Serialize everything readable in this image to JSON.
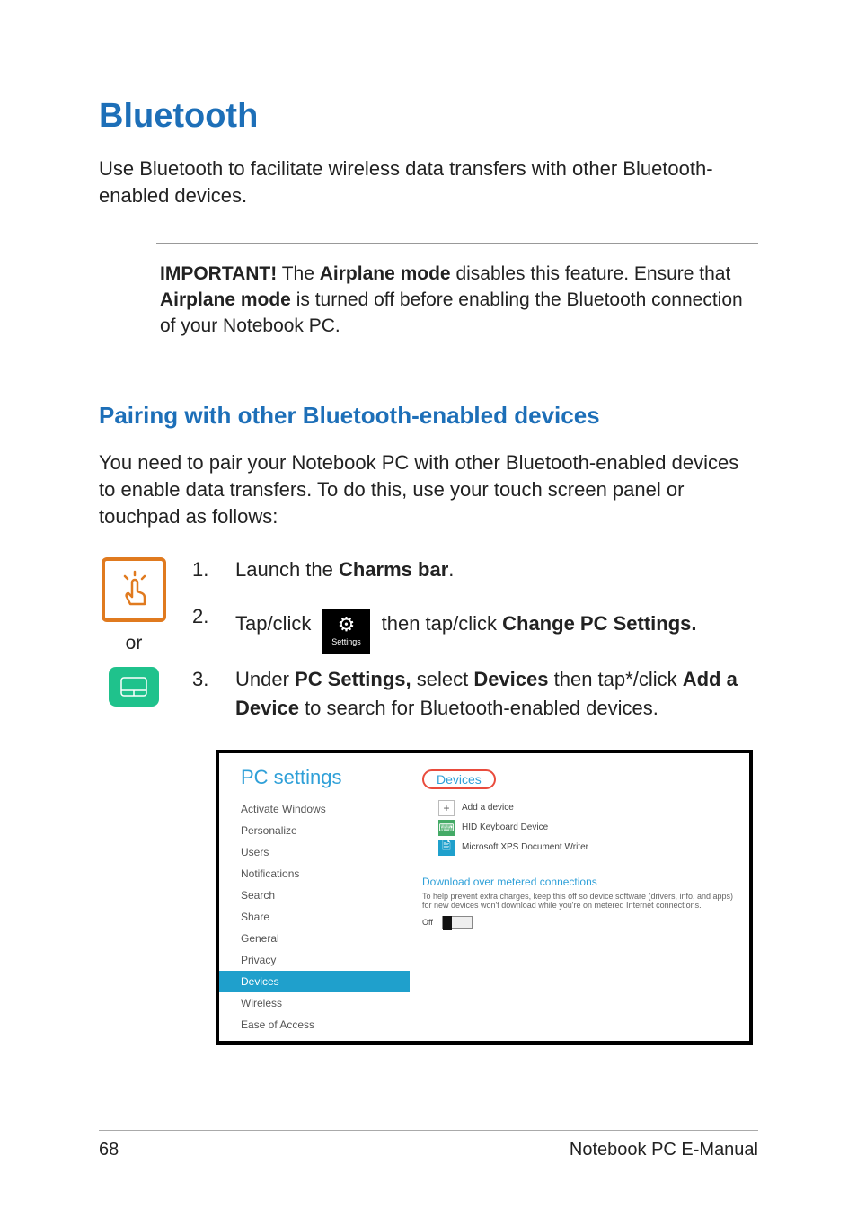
{
  "heading": "Bluetooth",
  "intro": "Use Bluetooth to facilitate wireless data transfers with other Bluetooth-enabled devices.",
  "important": {
    "label": "IMPORTANT!",
    "text_pre": " The ",
    "airplane1": "Airplane mode",
    "text_mid": " disables this feature. Ensure that ",
    "airplane2": "Airplane mode",
    "text_post": " is turned off before enabling the Bluetooth connection of your Notebook PC."
  },
  "subheading": "Pairing with other Bluetooth-enabled devices",
  "pairing_intro": "You need to pair your Notebook PC with other Bluetooth-enabled devices to enable data transfers. To do this, use your touch screen panel or touchpad as follows:",
  "icons": {
    "or": "or",
    "settings_label": "Settings"
  },
  "steps": {
    "s1": {
      "num": "1.",
      "pre": "Launch the ",
      "bold": "Charms bar",
      "post": "."
    },
    "s2": {
      "num": "2.",
      "pre": "Tap/click ",
      "mid": " then tap/click ",
      "bold": "Change PC Settings."
    },
    "s3": {
      "num": "3.",
      "pre": "Under ",
      "b1": "PC Settings,",
      "mid1": " select ",
      "b2": "Devices",
      "mid2": " then tap*/click ",
      "b3": "Add a Device",
      "post": " to search for Bluetooth-enabled devices."
    }
  },
  "screenshot": {
    "title": "PC settings",
    "items": [
      "Activate Windows",
      "Personalize",
      "Users",
      "Notifications",
      "Search",
      "Share",
      "General",
      "Privacy",
      "Devices",
      "Wireless",
      "Ease of Access"
    ],
    "devices_header": "Devices",
    "add": "Add a device",
    "kbd": "HID Keyboard Device",
    "xps": "Microsoft XPS Document Writer",
    "download_header": "Download over metered connections",
    "download_desc": "To help prevent extra charges, keep this off so device software (drivers, info, and apps) for new devices won't download while you're on metered Internet connections.",
    "off": "Off"
  },
  "footer": {
    "page": "68",
    "title": "Notebook PC E-Manual"
  }
}
